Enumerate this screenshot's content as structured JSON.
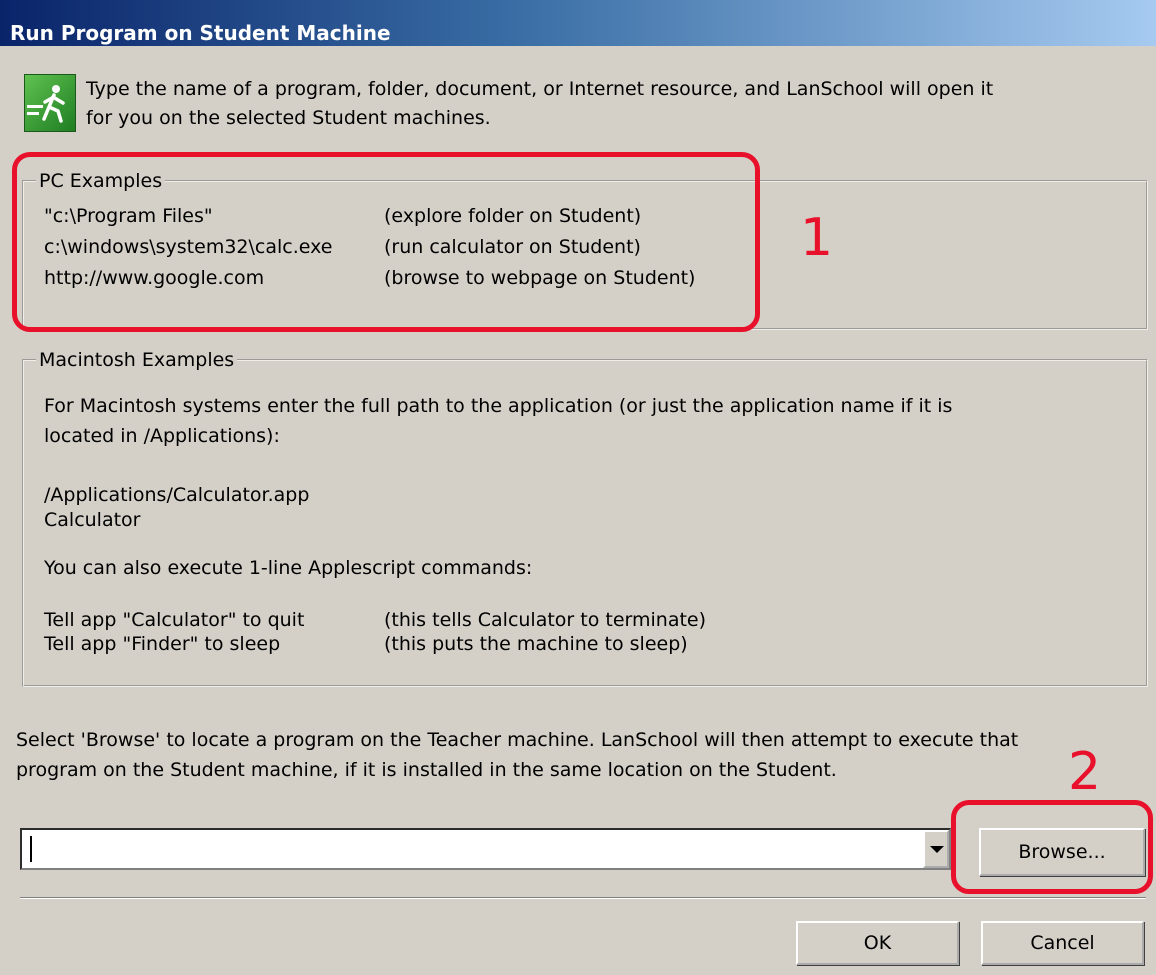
{
  "window": {
    "title": "Run Program on Student Machine"
  },
  "intro": {
    "text": "Type the name of a program, folder, document, or Internet resource, and LanSchool will open it\nfor you on the selected Student machines."
  },
  "pc_examples": {
    "legend": "PC Examples",
    "rows": [
      {
        "example": "\"c:\\Program Files\"",
        "description": "(explore folder on Student)"
      },
      {
        "example": "c:\\windows\\system32\\calc.exe",
        "description": "(run calculator on Student)"
      },
      {
        "example": "http://www.google.com",
        "description": "(browse to webpage on Student)"
      }
    ]
  },
  "mac_examples": {
    "legend": "Macintosh Examples",
    "description": "For Macintosh systems enter the full path to the application (or just the application name if it is\nlocated in /Applications):",
    "paths": [
      "/Applications/Calculator.app",
      "Calculator"
    ],
    "applescript_note": "You can also execute 1-line Applescript commands:",
    "commands": [
      {
        "example": "Tell app \"Calculator\" to quit",
        "description": "(this tells Calculator to terminate)"
      },
      {
        "example": "Tell app \"Finder\" to sleep",
        "description": "(this puts the machine to sleep)"
      }
    ]
  },
  "browse_note": "Select 'Browse' to locate a program on the Teacher machine. LanSchool will then attempt to execute that\nprogram on the Student machine, if it is installed in the same location on the Student.",
  "program_input": {
    "value": "",
    "icon": "chevron-down-icon"
  },
  "buttons": {
    "browse": "Browse...",
    "ok": "OK",
    "cancel": "Cancel"
  },
  "annotations": {
    "label_1": "1",
    "label_2": "2",
    "color": "#e8102a"
  },
  "colors": {
    "dialog_bg": "#d4d0c8",
    "titlebar_start": "#0a246a",
    "titlebar_end": "#a6caf0"
  }
}
